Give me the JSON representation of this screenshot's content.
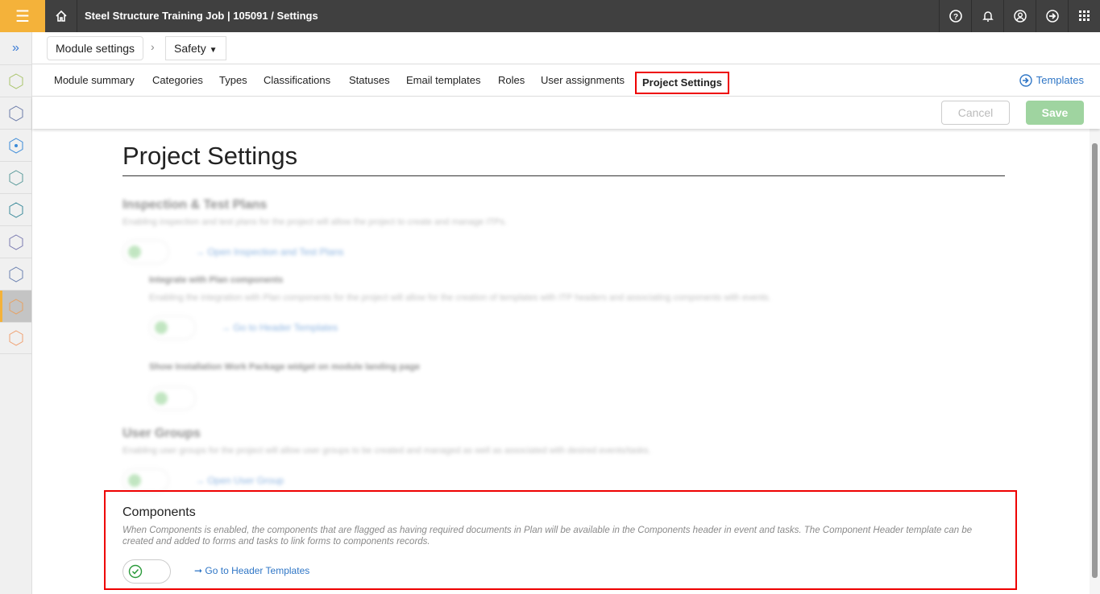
{
  "header": {
    "breadcrumb": "Steel Structure Training Job | 105091  /  Settings"
  },
  "breadcrumbs": {
    "module_settings": "Module settings",
    "module": "Safety"
  },
  "tabs": [
    "Module summary",
    "Categories",
    "Types",
    "Classifications",
    "Statuses",
    "Email templates",
    "Roles",
    "User assignments",
    "Project Settings"
  ],
  "templates_link": "Templates",
  "actions": {
    "cancel": "Cancel",
    "save": "Save"
  },
  "page": {
    "title": "Project Settings"
  },
  "itp": {
    "title": "Inspection & Test Plans",
    "desc": "Enabling inspection and test plans for the project will allow the project to create and manage ITPs.",
    "link": "→ Open Inspection and Test Plans",
    "integrate_title": "Integrate with Plan components",
    "integrate_desc": "Enabling the integration with Plan components for the project will allow for the creation of templates with ITP headers and associating components with events.",
    "integrate_link": "→ Go to Header Templates",
    "iwp_title": "Show Installation Work Package widget on module landing page"
  },
  "user_groups": {
    "title": "User Groups",
    "desc": "Enabling user groups for the project will allow user groups to be created and managed as well as associated with desired events/tasks.",
    "link": "→ Open User Group"
  },
  "components": {
    "title": "Components",
    "desc": "When Components is enabled, the components that are flagged as having required documents in Plan will be available in the Components header in event and tasks. The Component Header template can be created and added to forms and tasks to link forms to components records.",
    "link": "Go to Header Templates",
    "enabled": true
  }
}
